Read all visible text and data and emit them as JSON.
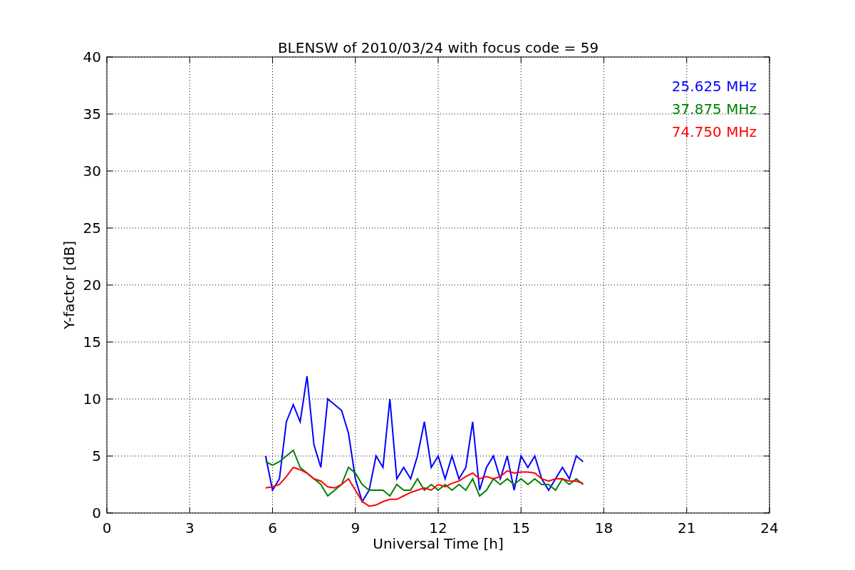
{
  "chart_data": {
    "type": "line",
    "title": "BLENSW of 2010/03/24 with focus code = 59",
    "xlabel": "Universal Time [h]",
    "ylabel": "Y-factor [dB]",
    "x": [
      5.75,
      6,
      6.25,
      6.5,
      6.75,
      7,
      7.25,
      7.5,
      7.75,
      8,
      8.25,
      8.5,
      8.75,
      9,
      9.25,
      9.5,
      9.75,
      10,
      10.25,
      10.5,
      10.75,
      11,
      11.25,
      11.5,
      11.75,
      12,
      12.25,
      12.5,
      12.75,
      13,
      13.25,
      13.5,
      13.75,
      14,
      14.25,
      14.5,
      14.75,
      15,
      15.25,
      15.5,
      15.75,
      16,
      16.25,
      16.5,
      16.75,
      17,
      17.25
    ],
    "series": [
      {
        "name": "25.625 MHz",
        "color": "#0000ff",
        "values": [
          5,
          2,
          3,
          8,
          9.5,
          8,
          12,
          6,
          4,
          10,
          9.5,
          9,
          7,
          3,
          1,
          2,
          5,
          4,
          10,
          3,
          4,
          3,
          5,
          8,
          4,
          5,
          3,
          5,
          3,
          4,
          8,
          2,
          4,
          5,
          3,
          5,
          2,
          5,
          4,
          5,
          3,
          2,
          3,
          4,
          3,
          5,
          4.5
        ]
      },
      {
        "name": "37.875 MHz",
        "color": "#008000",
        "values": [
          4.5,
          4.2,
          4.5,
          5,
          5.5,
          4,
          3.5,
          3,
          2.5,
          1.5,
          2,
          2.5,
          4,
          3.5,
          2.5,
          2,
          2,
          2,
          1.5,
          2.5,
          2,
          2,
          3,
          2,
          2.5,
          2,
          2.5,
          2,
          2.5,
          2,
          3,
          1.5,
          2,
          3,
          2.5,
          3,
          2.5,
          3,
          2.5,
          3,
          2.5,
          2.5,
          2,
          3,
          2.5,
          3,
          2.5
        ]
      },
      {
        "name": "74.750 MHz",
        "color": "#ff0000",
        "values": [
          2.2,
          2.3,
          2.5,
          3.2,
          4,
          3.8,
          3.5,
          3,
          2.8,
          2.3,
          2.2,
          2.5,
          3,
          2,
          1,
          0.6,
          0.7,
          1,
          1.2,
          1.2,
          1.5,
          1.8,
          2,
          2.2,
          2,
          2.5,
          2.3,
          2.6,
          2.8,
          3.2,
          3.5,
          3,
          3.2,
          3,
          3.2,
          3.7,
          3.5,
          3.6,
          3.6,
          3.5,
          3,
          2.8,
          3,
          3,
          2.8,
          2.8,
          2.6
        ]
      }
    ],
    "grid": true,
    "xlim": [
      0,
      24
    ],
    "ylim": [
      0,
      40
    ],
    "xticks": [
      0,
      3,
      6,
      9,
      12,
      15,
      18,
      21,
      24
    ],
    "yticks": [
      0,
      5,
      10,
      15,
      20,
      25,
      30,
      35,
      40
    ]
  }
}
